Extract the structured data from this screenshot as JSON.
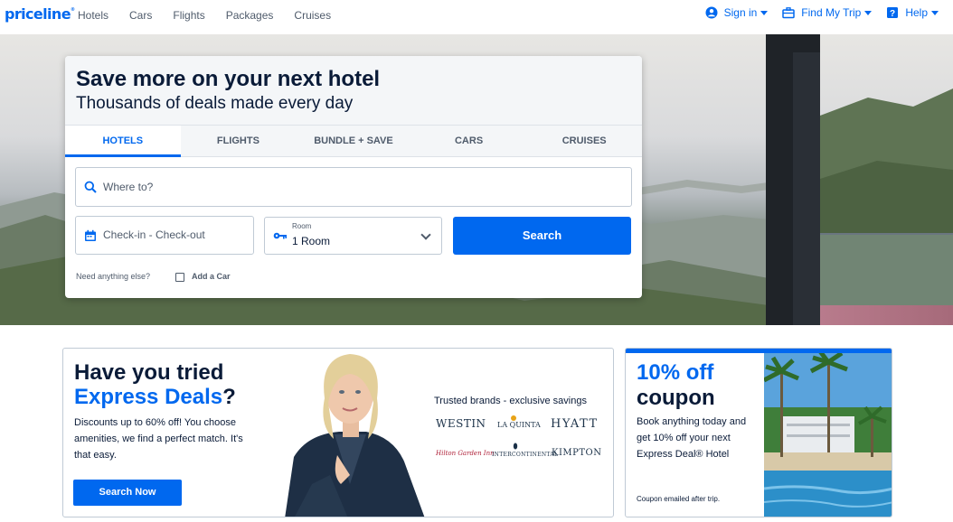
{
  "brand": {
    "logo": "priceline"
  },
  "nav": {
    "links": [
      "Hotels",
      "Cars",
      "Flights",
      "Packages",
      "Cruises"
    ],
    "sign_in": "Sign in",
    "find_trip": "Find My Trip",
    "help": "Help"
  },
  "hero": {
    "title": "Save more on your next hotel",
    "subtitle": "Thousands of deals made every day",
    "tabs": [
      "HOTELS",
      "FLIGHTS",
      "BUNDLE + SAVE",
      "CARS",
      "CRUISES"
    ],
    "where_placeholder": "Where to?",
    "dates_placeholder": "Check-in - Check-out",
    "room_label": "Room",
    "room_value": "1 Room",
    "search_label": "Search",
    "need_anything": "Need anything else?",
    "add_car": "Add a Car"
  },
  "express": {
    "title_line1": "Have you tried",
    "title_blue": "Express Deals",
    "title_end": "?",
    "desc": "Discounts up to 60% off! You choose amenities, we find a perfect match. It's that easy.",
    "button": "Search Now",
    "trusted": "Trusted brands - exclusive savings",
    "brands": [
      "WESTIN",
      "LA QUINTA",
      "HYATT",
      "Hilton Garden Inn",
      "INTERCONTINENTAL",
      "KIMPTON"
    ]
  },
  "coupon": {
    "title_blue": "10% off",
    "title_dark": "coupon",
    "desc": "Book anything today and get 10% off your next Express Deal® Hotel",
    "note": "Coupon emailed after trip."
  },
  "colors": {
    "brand_blue": "#0068ef",
    "navy": "#0a1b38",
    "gray_text": "#4f5b6b"
  }
}
